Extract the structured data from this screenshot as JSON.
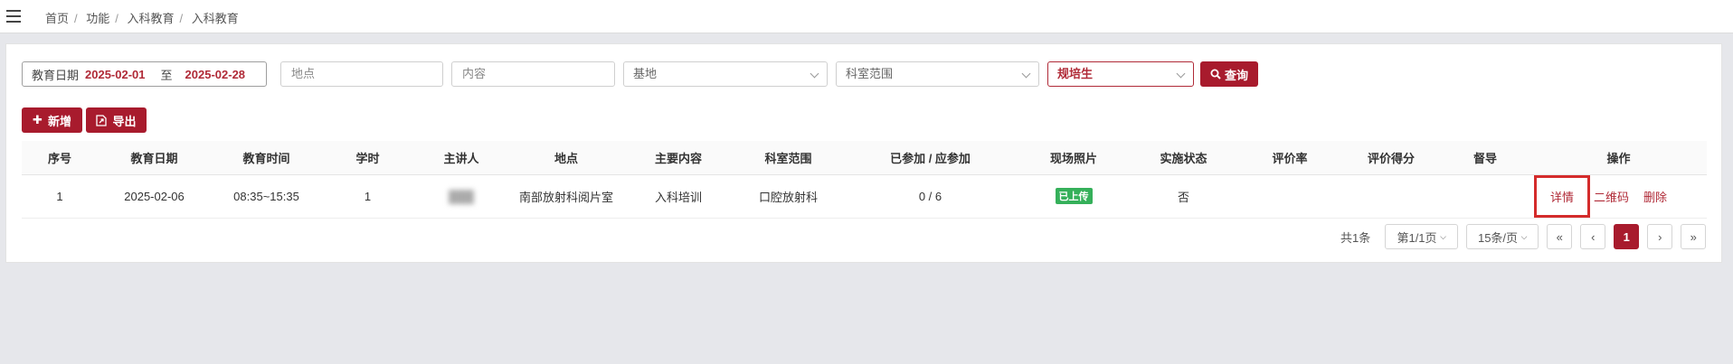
{
  "breadcrumb": [
    "首页",
    "功能",
    "入科教育",
    "入科教育"
  ],
  "filters": {
    "date_label": "教育日期",
    "date_from": "2025-02-01",
    "date_to_label": "至",
    "date_to": "2025-02-28",
    "location_placeholder": "地点",
    "content_placeholder": "内容",
    "base_placeholder": "基地",
    "dept_scope_placeholder": "科室范围",
    "trainee_type_value": "规培生",
    "search_label": "查询"
  },
  "toolbar": {
    "add_label": "新增",
    "export_label": "导出"
  },
  "table": {
    "headers": [
      "序号",
      "教育日期",
      "教育时间",
      "学时",
      "主讲人",
      "地点",
      "主要内容",
      "科室范围",
      "已参加 / 应参加",
      "现场照片",
      "实施状态",
      "评价率",
      "评价得分",
      "督导",
      "操作"
    ],
    "rows": [
      {
        "no": "1",
        "date": "2025-02-06",
        "time": "08:35~15:35",
        "hours": "1",
        "speaker": "███",
        "location": "南部放射科阅片室",
        "content": "入科培训",
        "dept_scope": "口腔放射科",
        "attendance": "0 / 6",
        "photo_badge": "已上传",
        "status": "否",
        "eval_rate": "",
        "eval_score": "",
        "supervision": "",
        "actions": {
          "detail": "详情",
          "qrcode": "二维码",
          "delete": "删除"
        }
      }
    ]
  },
  "pagination": {
    "total": "共1条",
    "page_select": "第1/1页",
    "size_select": "15条/页",
    "first": "«",
    "prev": "‹",
    "current": "1",
    "next": "›",
    "last": "»"
  },
  "colors": {
    "brand": "#a81b2d",
    "badge": "#35b05a",
    "highlight_box": "#d42b2b"
  }
}
